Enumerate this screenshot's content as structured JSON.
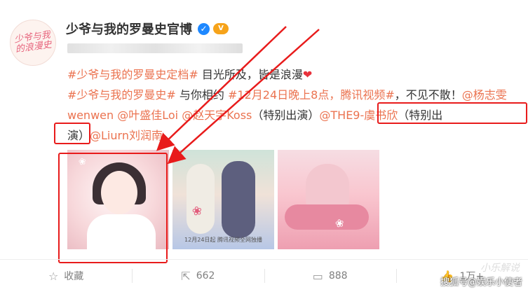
{
  "account": {
    "avatar_text": "少爷与我\n的浪漫史",
    "name": "少爷与我的罗曼史官博",
    "verified_icon": "verified-badge-icon",
    "vip_icon": "vip-badge-icon"
  },
  "post": {
    "line1_tag": "#少爷与我的罗曼史定档#",
    "line1_text": " 目光所及，皆是浪漫",
    "line1_heart": "❤",
    "line2_tag": "#少爷与我的罗曼史#",
    "line2_text": " 与你相约 ",
    "line2_tag2": "#12月24日晚上8点，腾讯视频#",
    "line2_text2": "，不见不散！",
    "mention_1": "@杨志雯wenwen",
    "mention_2": "@叶盛佳Loi",
    "mention_3": "@赵天宇Koss",
    "special_1": "（特别出演）",
    "mention_4": "@THE9-虞书欣",
    "special_2a": "（特别出",
    "special_2b": "演）",
    "mention_5": "@Liurn刘润南"
  },
  "images": {
    "img2_release": "12月24日起 腾讯视频全网独播"
  },
  "actions": {
    "favorite_label": "收藏",
    "repost_count": "662",
    "comment_count": "888",
    "like_count": "1万+"
  },
  "watermark": {
    "text": "搜狐号@娱乐小使者",
    "text2": "小乐解说"
  },
  "colors": {
    "accent": "#eb7350",
    "highlight": "#e81b1b",
    "verified": "#1e88ff"
  }
}
